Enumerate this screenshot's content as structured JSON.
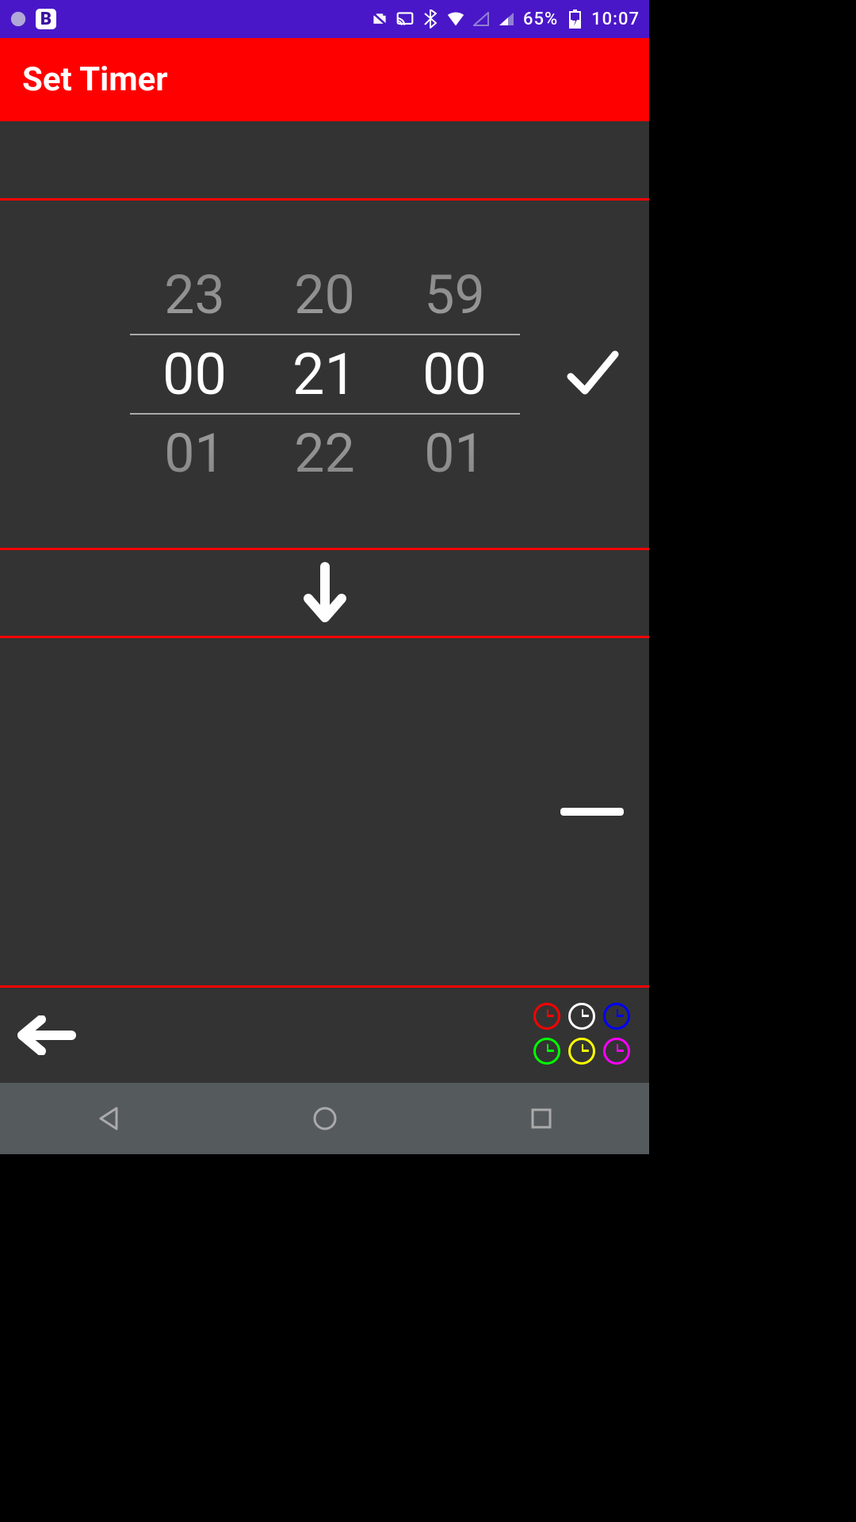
{
  "status_bar": {
    "battery_percent": "65%",
    "time": "10:07"
  },
  "title": "Set Timer",
  "picker": {
    "hours": {
      "prev": "23",
      "current": "00",
      "next": "01"
    },
    "minutes": {
      "prev": "20",
      "current": "21",
      "next": "22"
    },
    "seconds": {
      "prev": "59",
      "current": "00",
      "next": "01"
    }
  },
  "clock_colors": [
    "#FF0000",
    "#FFFFFF",
    "#0000FF",
    "#00FF00",
    "#FFFF00",
    "#FF00FF"
  ]
}
